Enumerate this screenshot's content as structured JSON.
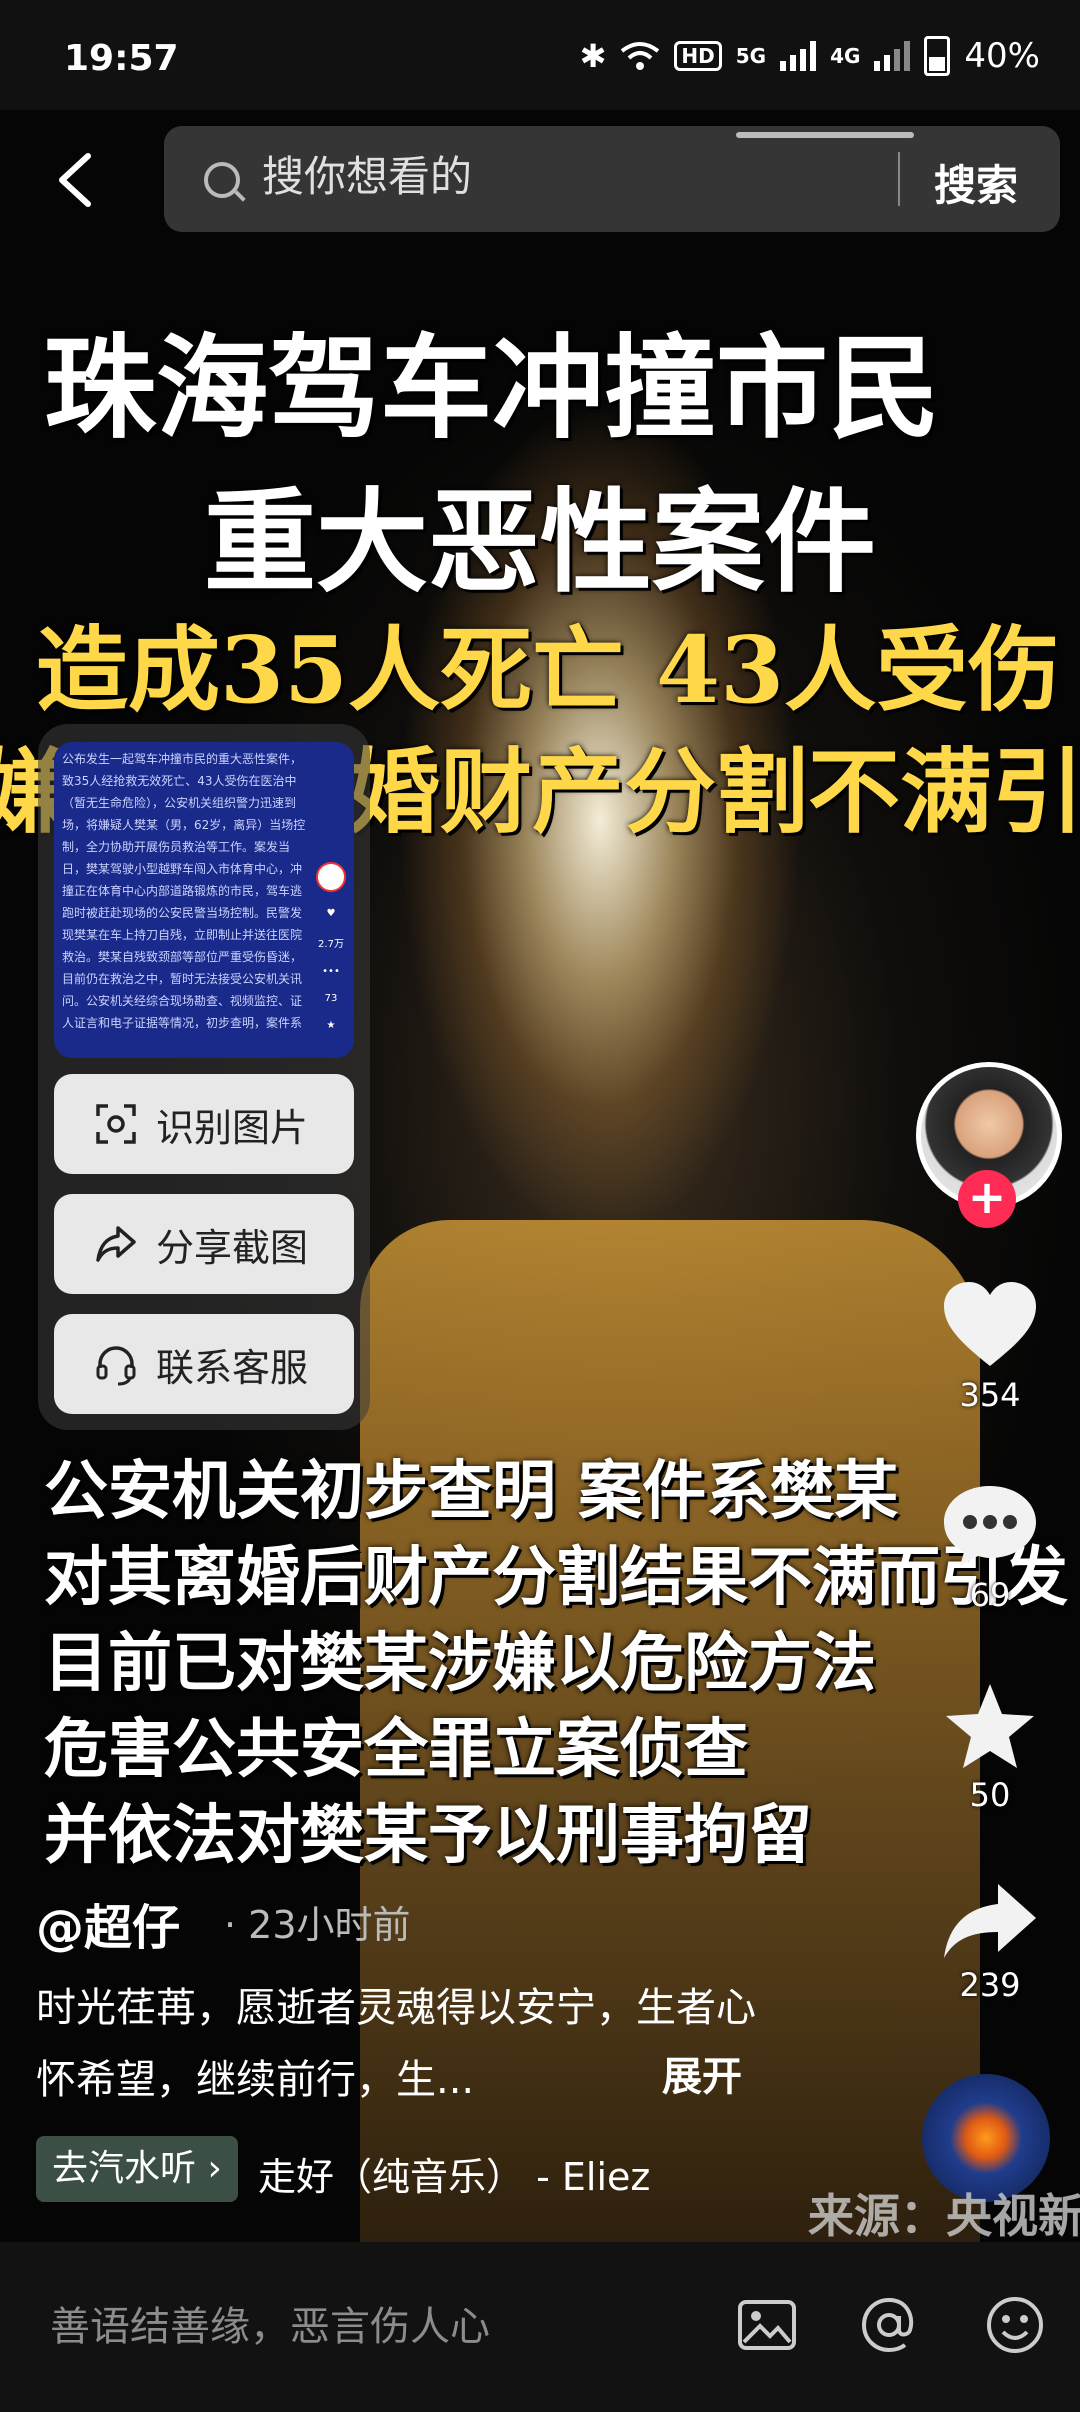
{
  "status_bar": {
    "time": "19:57",
    "hd": "HD",
    "net1": "5G",
    "net2": "4G",
    "battery": "40%"
  },
  "search": {
    "placeholder": "搜你想看的",
    "button": "搜索"
  },
  "video": {
    "title_line1": "珠海驾车冲撞市民",
    "title_line2": "重大恶性案件",
    "yellow_line1": "造成35人死亡  43人受伤",
    "yellow_line2": "嫌疑人离婚财产分割不满引",
    "subtitles": [
      "公安机关初步查明  案件系樊某",
      "对其离婚后财产分割结果不满而引发",
      "目前已对樊某涉嫌以危险方法",
      "危害公共安全罪立案侦查",
      "并依法对樊某予以刑事拘留"
    ],
    "source": "来源：央视新"
  },
  "context_panel": {
    "thumb_text": "公布发生一起驾车冲撞市民的重大恶性案件，致35人经抢救无效死亡、43人受伤在医治中（暂无生命危险），公安机关组织警力迅速到场，将嫌疑人樊某（男，62岁，离异）当场控制，全力协助开展伤员救治等工作。案发当日，樊某驾驶小型越野车闯入市体育中心，冲撞正在体育中心内部道路锻炼的市民，驾车逃跑时被赶赴现场的公安民警当场控制。民警发现樊某在车上持刀自残，立即制止并送往医院救治。樊某自残致颈部等部位严重受伤昏迷，目前仍在救治之中，暂时无法接受公安机关讯问。公安机关经综合现场勘查、视频监控、证人证言和电子证据等情况，初步查明，案件系",
    "thumb_counts": {
      "likes": "2.7万",
      "comments": "73"
    },
    "buttons": [
      {
        "label": "识别图片",
        "icon": "scan-icon"
      },
      {
        "label": "分享截图",
        "icon": "share-icon"
      },
      {
        "label": "联系客服",
        "icon": "headset-icon"
      }
    ]
  },
  "actions": {
    "likes": "354",
    "comments": "69",
    "favorites": "50",
    "shares": "239"
  },
  "post": {
    "author": "@超仔",
    "time": "· 23小时前",
    "description": "时光荏苒，愿逝者灵魂得以安宁，生者心怀希望，继续前行，生...",
    "expand": "展开",
    "music_tag": "去汽水听 ›",
    "music_name": "走好（纯音乐） - Eliez"
  },
  "comment_bar": {
    "placeholder": "善语结善缘，恶言伤人心"
  }
}
